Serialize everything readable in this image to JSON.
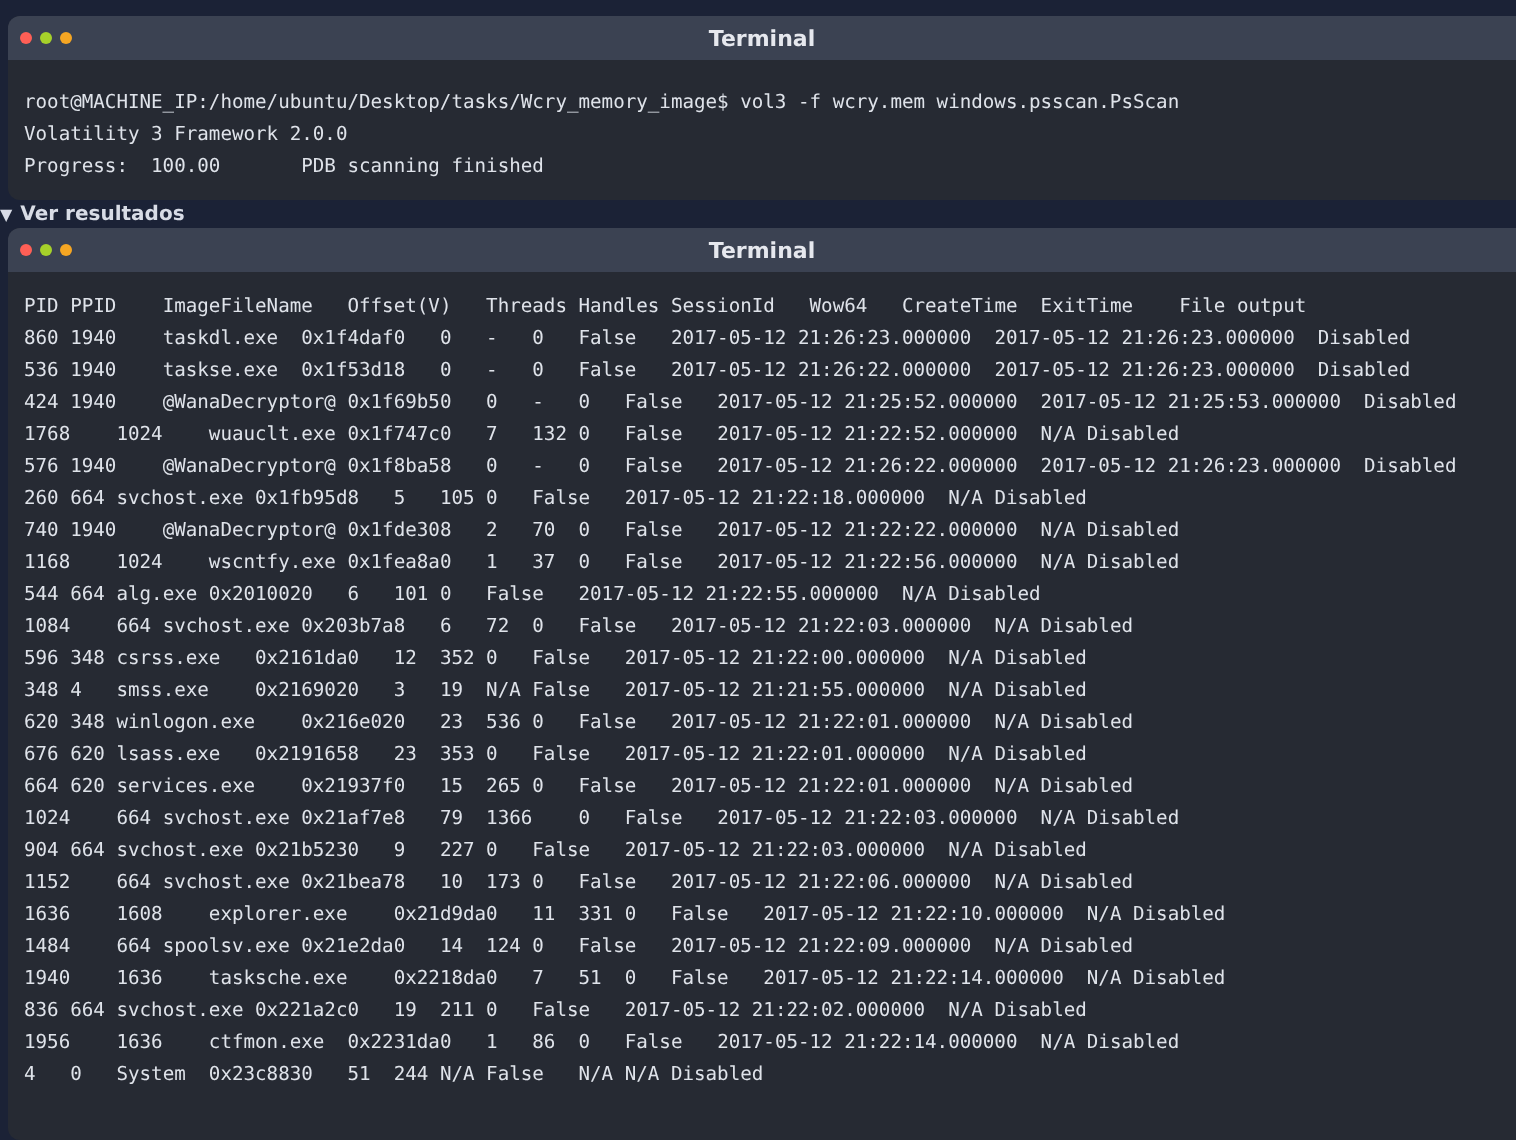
{
  "command_window": {
    "title": "Terminal",
    "lines": [
      "root@MACHINE_IP:/home/ubuntu/Desktop/tasks/Wcry_memory_image$ vol3 -f wcry.mem windows.psscan.PsScan",
      "Volatility 3 Framework 2.0.0",
      "Progress:  100.00\t\tPDB scanning finished"
    ]
  },
  "results_toggle": {
    "icon": "▼",
    "label": "Ver resultados",
    "expanded": true
  },
  "results_window": {
    "title": "Terminal",
    "lines": [
      "PID\tPPID\tImageFileName\tOffset(V)\tThreads\tHandles\tSessionId\tWow64\tCreateTime\tExitTime\tFile output",
      "860\t1940\ttaskdl.exe\t0x1f4daf0\t0\t-\t0\tFalse\t2017-05-12 21:26:23.000000\t2017-05-12 21:26:23.000000\tDisabled",
      "536\t1940\ttaskse.exe\t0x1f53d18\t0\t-\t0\tFalse\t2017-05-12 21:26:22.000000\t2017-05-12 21:26:23.000000\tDisabled",
      "424\t1940\t@WanaDecryptor@\t0x1f69b50\t0\t-\t0\tFalse\t2017-05-12 21:25:52.000000\t2017-05-12 21:25:53.000000\tDisabled",
      "1768\t1024\twuauclt.exe\t0x1f747c0\t7\t132\t0\tFalse\t2017-05-12 21:22:52.000000\tN/A\tDisabled",
      "576\t1940\t@WanaDecryptor@\t0x1f8ba58\t0\t-\t0\tFalse\t2017-05-12 21:26:22.000000\t2017-05-12 21:26:23.000000\tDisabled",
      "260\t664\tsvchost.exe\t0x1fb95d8\t5\t105\t0\tFalse\t2017-05-12 21:22:18.000000\tN/A\tDisabled",
      "740\t1940\t@WanaDecryptor@\t0x1fde308\t2\t70\t0\tFalse\t2017-05-12 21:22:22.000000\tN/A\tDisabled",
      "1168\t1024\twscntfy.exe\t0x1fea8a0\t1\t37\t0\tFalse\t2017-05-12 21:22:56.000000\tN/A\tDisabled",
      "544\t664\talg.exe\t0x2010020\t6\t101\t0\tFalse\t2017-05-12 21:22:55.000000\tN/A\tDisabled",
      "1084\t664\tsvchost.exe\t0x203b7a8\t6\t72\t0\tFalse\t2017-05-12 21:22:03.000000\tN/A\tDisabled",
      "596\t348\tcsrss.exe\t0x2161da0\t12\t352\t0\tFalse\t2017-05-12 21:22:00.000000\tN/A\tDisabled",
      "348\t4\tsmss.exe\t0x2169020\t3\t19\tN/A\tFalse\t2017-05-12 21:21:55.000000\tN/A\tDisabled",
      "620\t348\twinlogon.exe\t0x216e020\t23\t536\t0\tFalse\t2017-05-12 21:22:01.000000\tN/A\tDisabled",
      "676\t620\tlsass.exe\t0x2191658\t23\t353\t0\tFalse\t2017-05-12 21:22:01.000000\tN/A\tDisabled",
      "664\t620\tservices.exe\t0x21937f0\t15\t265\t0\tFalse\t2017-05-12 21:22:01.000000\tN/A\tDisabled",
      "1024\t664\tsvchost.exe\t0x21af7e8\t79\t1366\t0\tFalse\t2017-05-12 21:22:03.000000\tN/A\tDisabled",
      "904\t664\tsvchost.exe\t0x21b5230\t9\t227\t0\tFalse\t2017-05-12 21:22:03.000000\tN/A\tDisabled",
      "1152\t664\tsvchost.exe\t0x21bea78\t10\t173\t0\tFalse\t2017-05-12 21:22:06.000000\tN/A\tDisabled",
      "1636\t1608\texplorer.exe\t0x21d9da0\t11\t331\t0\tFalse\t2017-05-12 21:22:10.000000\tN/A\tDisabled",
      "1484\t664\tspoolsv.exe\t0x21e2da0\t14\t124\t0\tFalse\t2017-05-12 21:22:09.000000\tN/A\tDisabled",
      "1940\t1636\ttasksche.exe\t0x2218da0\t7\t51\t0\tFalse\t2017-05-12 21:22:14.000000\tN/A\tDisabled",
      "836\t664\tsvchost.exe\t0x221a2c0\t19\t211\t0\tFalse\t2017-05-12 21:22:02.000000\tN/A\tDisabled",
      "1956\t1636\tctfmon.exe\t0x2231da0\t1\t86\t0\tFalse\t2017-05-12 21:22:14.000000\tN/A\tDisabled",
      "4\t0\tSystem\t0x23c8830\t51\t244\tN/A\tFalse\tN/A\tN/A\tDisabled"
    ]
  }
}
